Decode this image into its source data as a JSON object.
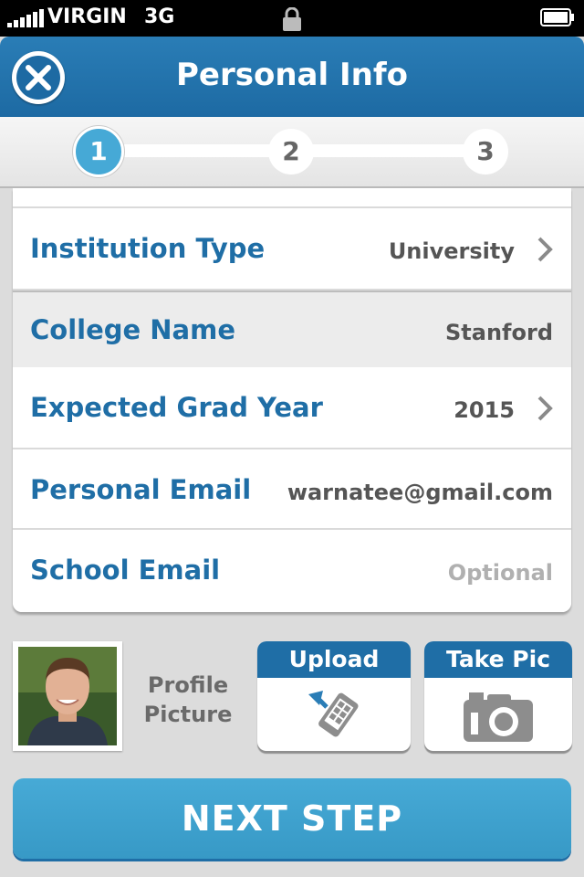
{
  "status_bar": {
    "carrier": "VIRGIN",
    "network": "3G"
  },
  "header": {
    "title": "Personal Info",
    "close_icon": "close-x-icon"
  },
  "stepper": {
    "steps": [
      "1",
      "2",
      "3"
    ],
    "active_step": "1"
  },
  "form": {
    "rows": [
      {
        "label": "Institution Type",
        "value": "University",
        "has_chevron": true
      },
      {
        "label": "College Name",
        "value": "Stanford",
        "has_chevron": false
      },
      {
        "label": "Expected Grad Year",
        "value": "2015",
        "has_chevron": true
      },
      {
        "label": "Personal Email",
        "value": "warnatee@gmail.com",
        "has_chevron": false
      },
      {
        "label": "School Email",
        "value": "Optional",
        "has_chevron": false
      }
    ]
  },
  "profile": {
    "label_line1": "Profile",
    "label_line2": "Picture",
    "upload_label": "Upload",
    "take_pic_label": "Take Pic"
  },
  "next_button": "NEXT STEP",
  "colors": {
    "primary": "#1f6ea6",
    "accent": "#46a9d6",
    "background": "#dcdcdc"
  }
}
